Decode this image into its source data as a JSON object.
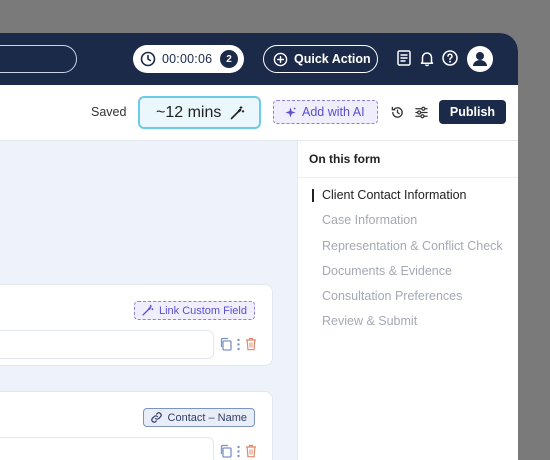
{
  "header": {
    "timer": "00:00:06",
    "timer_count": "2",
    "quick_action_label": "Quick Action"
  },
  "toolbar": {
    "saved_label": "Saved",
    "time_estimate": "~12 mins",
    "add_ai_label": "Add with AI",
    "publish_label": "Publish"
  },
  "fields": [
    {
      "chip_label": "Link Custom Field"
    },
    {
      "chip_label": "Contact – Name"
    }
  ],
  "sidebar": {
    "title": "On this form",
    "items": [
      {
        "label": "Client Contact Information",
        "active": true
      },
      {
        "label": "Case Information"
      },
      {
        "label": "Representation & Conflict Check"
      },
      {
        "label": "Documents & Evidence"
      },
      {
        "label": "Consultation Preferences"
      },
      {
        "label": "Review & Submit"
      }
    ]
  },
  "colors": {
    "navy": "#1c2a4a",
    "ai_purple": "#5a4fcf",
    "time_border": "#6ccbe6",
    "delete_red": "#e08a6e"
  },
  "icons": [
    "clock-icon",
    "plus-circle-icon",
    "notes-icon",
    "bell-icon",
    "help-icon",
    "user-icon",
    "magic-wand-icon",
    "sparkle-icon",
    "history-icon",
    "sliders-icon",
    "link-icon",
    "copy-icon",
    "more-icon",
    "trash-icon"
  ]
}
